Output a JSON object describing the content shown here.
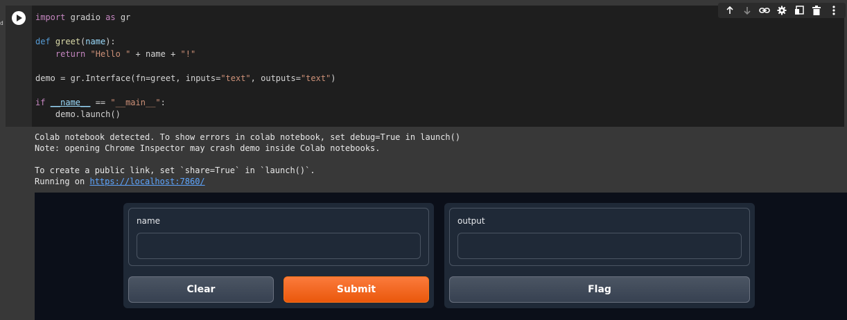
{
  "cell": {
    "execution_marker": "d",
    "code": {
      "l1_kw": "import",
      "l1_rest": " gradio ",
      "l1_kw2": "as",
      "l1_end": " gr",
      "l3_kw": "def",
      "l3_fn": "greet",
      "l3_arg": "name",
      "l3_end": "):",
      "l4_indent": "    ",
      "l4_kw": "return",
      "l4_str1": "\"Hello \"",
      "l4_mid": " + name + ",
      "l4_str2": "\"!\"",
      "l6_pre": "demo = gr.Interface(fn=greet, inputs=",
      "l6_str1": "\"text\"",
      "l6_mid": ", outputs=",
      "l6_str2": "\"text\"",
      "l6_end": ")",
      "l8_kw": "if",
      "l8_var": "__name__",
      "l8_eq": " == ",
      "l8_str": "\"__main__\"",
      "l8_end": ":",
      "l9": "    demo.launch()"
    }
  },
  "toolbar": {
    "icons": [
      "arrow-up-icon",
      "arrow-down-icon",
      "link-icon",
      "gear-icon",
      "mirror-cell-icon",
      "trash-icon",
      "more-vertical-icon"
    ]
  },
  "output": {
    "line1": "Colab notebook detected. To show errors in colab notebook, set debug=True in launch()",
    "line2": "Note: opening Chrome Inspector may crash demo inside Colab notebooks.",
    "line4": "To create a public link, set `share=True` in `launch()`.",
    "line5_prefix": "Running on ",
    "line5_link": "https://localhost:7860/"
  },
  "gradio": {
    "input_label": "name",
    "input_value": "",
    "output_label": "output",
    "output_value": "",
    "clear_label": "Clear",
    "submit_label": "Submit",
    "flag_label": "Flag"
  },
  "colors": {
    "accent": "#f97316",
    "link": "#5ea6ff",
    "app_background": "#0b0f19",
    "panel": "#1f2937"
  }
}
